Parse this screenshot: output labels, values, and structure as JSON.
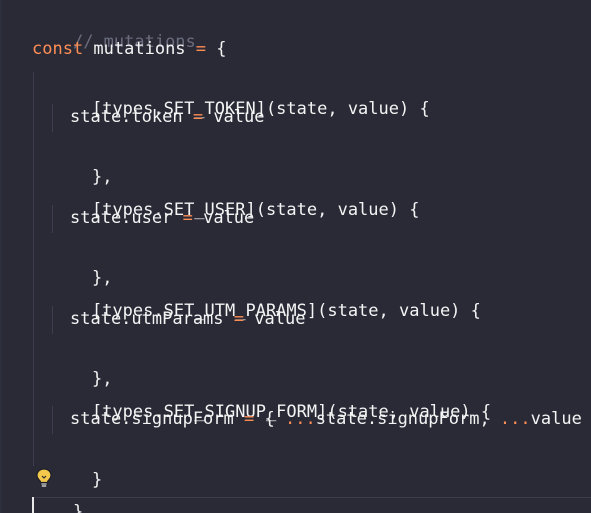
{
  "code_lines": [
    {
      "comment": "// mutations"
    },
    {
      "kw": "const",
      "name": " mutations ",
      "op": "=",
      "rest": " {"
    },
    {
      "text": "[types.SET_TOKEN](state, value) {"
    },
    {
      "pre": "state.token ",
      "op": "=",
      "post": " value"
    },
    {
      "text": "},"
    },
    {
      "text": "[types.SET_USER](state, value) {"
    },
    {
      "pre": "state.user ",
      "op": "=",
      "post": " value"
    },
    {
      "text": "},"
    },
    {
      "text": "[types.SET_UTM_PARAMS](state, value) {"
    },
    {
      "pre": "state.utmParams ",
      "op": "=",
      "post": " value"
    },
    {
      "text": "},"
    },
    {
      "text": "[types.SET_SIGNUP_FORM](state, value) {"
    },
    {
      "pre": "state.signupForm ",
      "op": "=",
      "mid": " { ",
      "spread1": "...",
      "mid2": "state.signupForm, ",
      "spread2": "...",
      "post": "value }"
    },
    {
      "text": "}"
    },
    {
      "text": "}"
    }
  ],
  "colors": {
    "background": "#292a36",
    "keyword": "#ff8d54",
    "comment": "#6a6c7d",
    "text": "#f4f4f4",
    "bulb": "#f2c94c"
  },
  "icons": {
    "lightbulb": "lightbulb-icon"
  }
}
